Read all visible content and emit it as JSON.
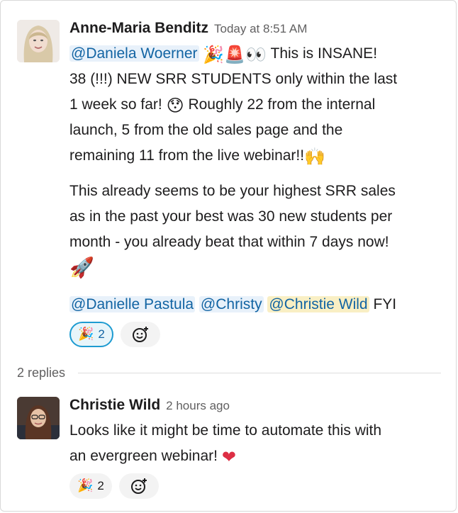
{
  "messages": [
    {
      "sender": "Anne-Maria Benditz",
      "time": "Today at 8:51 AM",
      "mention_1": "@Daniela Woerner",
      "line_1_text": "This is INSANE!",
      "line_2": "38 (!!!) NEW SRR STUDENTS only within the last",
      "line_3_a": "1 week so far!",
      "line_3_b": "Roughly 22 from the internal",
      "line_4": "launch, 5 from the old sales page and the",
      "line_5": "remaining 11 from the live webinar!!",
      "para_2_line_1": "This already seems to be your highest SRR sales",
      "para_2_line_2": "as in the past your best was 30 new students per",
      "para_2_line_3": "month - you already beat that within 7 days now!",
      "mentions": [
        "@Danielle Pastula",
        "@Christy",
        "@Christie Wild"
      ],
      "trailing_text": "FYI",
      "reaction": {
        "emoji": "party-popper",
        "count": "2"
      }
    },
    {
      "sender": "Christie Wild",
      "time": "2 hours ago",
      "line_1": "Looks like it might be time to automate this with",
      "line_2": "an evergreen webinar!",
      "reaction": {
        "emoji": "party-popper",
        "count": "2"
      }
    }
  ],
  "replies": {
    "label": "2 replies"
  },
  "icons": {
    "emojis_message_1_line_1": [
      "party-popper-icon",
      "police-light-icon",
      "eyes-icon"
    ],
    "emoji_surprised": "hushed-face-icon",
    "emoji_raised_hands": "raised-hands-icon",
    "emoji_rocket": "rocket-icon",
    "emoji_heart": "red-heart-icon",
    "add_reaction": "add-reaction-icon"
  },
  "colors": {
    "mention_bg": "#e8f1fa",
    "mention_text": "#1264a3",
    "self_mention_bg": "#f9efc4",
    "reaction_active_border": "#1d9bd1",
    "heart": "#dd2e44"
  }
}
